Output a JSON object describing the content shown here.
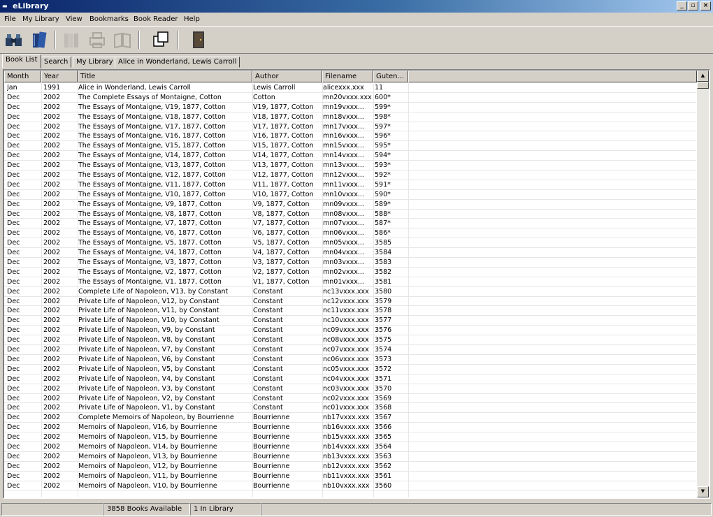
{
  "window": {
    "title": "eLibrary",
    "controls": [
      "minimize",
      "maximize",
      "close"
    ]
  },
  "menu": [
    "File",
    "My Library",
    "View",
    "Bookmarks",
    "Book Reader",
    "Help"
  ],
  "toolbar": {
    "buttons": [
      {
        "icon": "binoculars-icon",
        "enabled": true
      },
      {
        "icon": "books-icon",
        "enabled": true
      },
      {
        "icon": "bookshelf-icon",
        "enabled": false
      },
      {
        "icon": "print-icon",
        "enabled": false
      },
      {
        "icon": "open-book-icon",
        "enabled": false
      },
      {
        "icon": "copy-icon",
        "enabled": true
      },
      {
        "icon": "exit-door-icon",
        "enabled": true
      }
    ]
  },
  "tabs": [
    "Book List",
    "Search",
    "My Library",
    "Alice in Wonderland, Lewis Carroll"
  ],
  "active_tab": "Book List",
  "table": {
    "columns": [
      "Month",
      "Year",
      "Title",
      "Author",
      "Filename",
      "Guten..."
    ],
    "rows": [
      [
        "Jan",
        "1991",
        "Alice in Wonderland, Lewis Carroll",
        "Lewis Carroll",
        "alicexxx.xxx",
        "11"
      ],
      [
        "Dec",
        "2002",
        "The Complete Essays of Montaigne, Cotton",
        "Cotton",
        "mn20vxxx.xxx",
        "600*"
      ],
      [
        "Dec",
        "2002",
        "The Essays of Montaigne, V19, 1877, Cotton",
        "V19, 1877, Cotton",
        "mn19vxxx...",
        "599*"
      ],
      [
        "Dec",
        "2002",
        "The Essays of Montaigne, V18, 1877, Cotton",
        "V18, 1877, Cotton",
        "mn18vxxx...",
        "598*"
      ],
      [
        "Dec",
        "2002",
        "The Essays of Montaigne, V17, 1877, Cotton",
        "V17, 1877, Cotton",
        "mn17vxxx...",
        "597*"
      ],
      [
        "Dec",
        "2002",
        "The Essays of Montaigne, V16, 1877, Cotton",
        "V16, 1877, Cotton",
        "mn16vxxx...",
        "596*"
      ],
      [
        "Dec",
        "2002",
        "The Essays of Montaigne, V15, 1877, Cotton",
        "V15, 1877, Cotton",
        "mn15vxxx...",
        "595*"
      ],
      [
        "Dec",
        "2002",
        "The Essays of Montaigne, V14, 1877, Cotton",
        "V14, 1877, Cotton",
        "mn14vxxx...",
        "594*"
      ],
      [
        "Dec",
        "2002",
        "The Essays of Montaigne, V13, 1877, Cotton",
        "V13, 1877, Cotton",
        "mn13vxxx...",
        "593*"
      ],
      [
        "Dec",
        "2002",
        "The Essays of Montaigne, V12, 1877, Cotton",
        "V12, 1877, Cotton",
        "mn12vxxx...",
        "592*"
      ],
      [
        "Dec",
        "2002",
        "The Essays of Montaigne, V11, 1877, Cotton",
        "V11, 1877, Cotton",
        "mn11vxxx...",
        "591*"
      ],
      [
        "Dec",
        "2002",
        "The Essays of Montaigne, V10, 1877, Cotton",
        "V10, 1877, Cotton",
        "mn10vxxx...",
        "590*"
      ],
      [
        "Dec",
        "2002",
        "The Essays of Montaigne, V9, 1877, Cotton",
        "V9, 1877, Cotton",
        "mn09vxxx...",
        "589*"
      ],
      [
        "Dec",
        "2002",
        "The Essays of Montaigne, V8, 1877, Cotton",
        "V8, 1877, Cotton",
        "mn08vxxx...",
        "588*"
      ],
      [
        "Dec",
        "2002",
        "The Essays of Montaigne, V7, 1877, Cotton",
        "V7, 1877, Cotton",
        "mn07vxxx...",
        "587*"
      ],
      [
        "Dec",
        "2002",
        "The Essays of Montaigne, V6, 1877, Cotton",
        "V6, 1877, Cotton",
        "mn06vxxx...",
        "586*"
      ],
      [
        "Dec",
        "2002",
        "The Essays of Montaigne, V5, 1877, Cotton",
        "V5, 1877, Cotton",
        "mn05vxxx...",
        "3585"
      ],
      [
        "Dec",
        "2002",
        "The Essays of Montaigne, V4, 1877, Cotton",
        "V4, 1877, Cotton",
        "mn04vxxx...",
        "3584"
      ],
      [
        "Dec",
        "2002",
        "The Essays of Montaigne, V3, 1877, Cotton",
        "V3, 1877, Cotton",
        "mn03vxxx...",
        "3583"
      ],
      [
        "Dec",
        "2002",
        "The Essays of Montaigne, V2, 1877, Cotton",
        "V2, 1877, Cotton",
        "mn02vxxx...",
        "3582"
      ],
      [
        "Dec",
        "2002",
        "The Essays of Montaigne, V1, 1877, Cotton",
        "V1, 1877, Cotton",
        "mn01vxxx...",
        "3581"
      ],
      [
        "Dec",
        "2002",
        "Complete Life of Napoleon, V13, by Constant",
        "Constant",
        "nc13vxxx.xxx",
        "3580"
      ],
      [
        "Dec",
        "2002",
        "Private Life of Napoleon, V12, by Constant",
        "Constant",
        "nc12vxxx.xxx",
        "3579"
      ],
      [
        "Dec",
        "2002",
        "Private Life of Napoleon, V11, by Constant",
        "Constant",
        "nc11vxxx.xxx",
        "3578"
      ],
      [
        "Dec",
        "2002",
        "Private Life of Napoleon, V10, by Constant",
        "Constant",
        "nc10vxxx.xxx",
        "3577"
      ],
      [
        "Dec",
        "2002",
        "Private Life of Napoleon, V9, by Constant",
        "Constant",
        "nc09vxxx.xxx",
        "3576"
      ],
      [
        "Dec",
        "2002",
        "Private Life of Napoleon, V8, by Constant",
        "Constant",
        "nc08vxxx.xxx",
        "3575"
      ],
      [
        "Dec",
        "2002",
        "Private Life of Napoleon, V7, by Constant",
        "Constant",
        "nc07vxxx.xxx",
        "3574"
      ],
      [
        "Dec",
        "2002",
        "Private Life of Napoleon, V6, by Constant",
        "Constant",
        "nc06vxxx.xxx",
        "3573"
      ],
      [
        "Dec",
        "2002",
        "Private Life of Napoleon, V5, by Constant",
        "Constant",
        "nc05vxxx.xxx",
        "3572"
      ],
      [
        "Dec",
        "2002",
        "Private Life of Napoleon, V4, by Constant",
        "Constant",
        "nc04vxxx.xxx",
        "3571"
      ],
      [
        "Dec",
        "2002",
        "Private Life of Napoleon, V3, by Constant",
        "Constant",
        "nc03vxxx.xxx",
        "3570"
      ],
      [
        "Dec",
        "2002",
        "Private Life of Napoleon, V2, by Constant",
        "Constant",
        "nc02vxxx.xxx",
        "3569"
      ],
      [
        "Dec",
        "2002",
        "Private Life of Napoleon, V1, by Constant",
        "Constant",
        "nc01vxxx.xxx",
        "3568"
      ],
      [
        "Dec",
        "2002",
        "Complete Memoirs of Napoleon, by Bourrienne",
        "Bourrienne",
        "nb17vxxx.xxx",
        "3567"
      ],
      [
        "Dec",
        "2002",
        "Memoirs of Napoleon, V16, by Bourrienne",
        "Bourrienne",
        "nb16vxxx.xxx",
        "3566"
      ],
      [
        "Dec",
        "2002",
        "Memoirs of Napoleon, V15, by Bourrienne",
        "Bourrienne",
        "nb15vxxx.xxx",
        "3565"
      ],
      [
        "Dec",
        "2002",
        "Memoirs of Napoleon, V14, by Bourrienne",
        "Bourrienne",
        "nb14vxxx.xxx",
        "3564"
      ],
      [
        "Dec",
        "2002",
        "Memoirs of Napoleon, V13, by Bourrienne",
        "Bourrienne",
        "nb13vxxx.xxx",
        "3563"
      ],
      [
        "Dec",
        "2002",
        "Memoirs of Napoleon, V12, by Bourrienne",
        "Bourrienne",
        "nb12vxxx.xxx",
        "3562"
      ],
      [
        "Dec",
        "2002",
        "Memoirs of Napoleon, V11, by Bourrienne",
        "Bourrienne",
        "nb11vxxx.xxx",
        "3561"
      ],
      [
        "Dec",
        "2002",
        "Memoirs of Napoleon, V10, by Bourrienne",
        "Bourrienne",
        "nb10vxxx.xxx",
        "3560"
      ]
    ]
  },
  "status": {
    "books_available": "3858 Books Available",
    "in_library": "1 In Library"
  },
  "colors": {
    "titlebar_start": "#0a246a",
    "titlebar_end": "#a6caf0",
    "face": "#d4d0c8"
  }
}
